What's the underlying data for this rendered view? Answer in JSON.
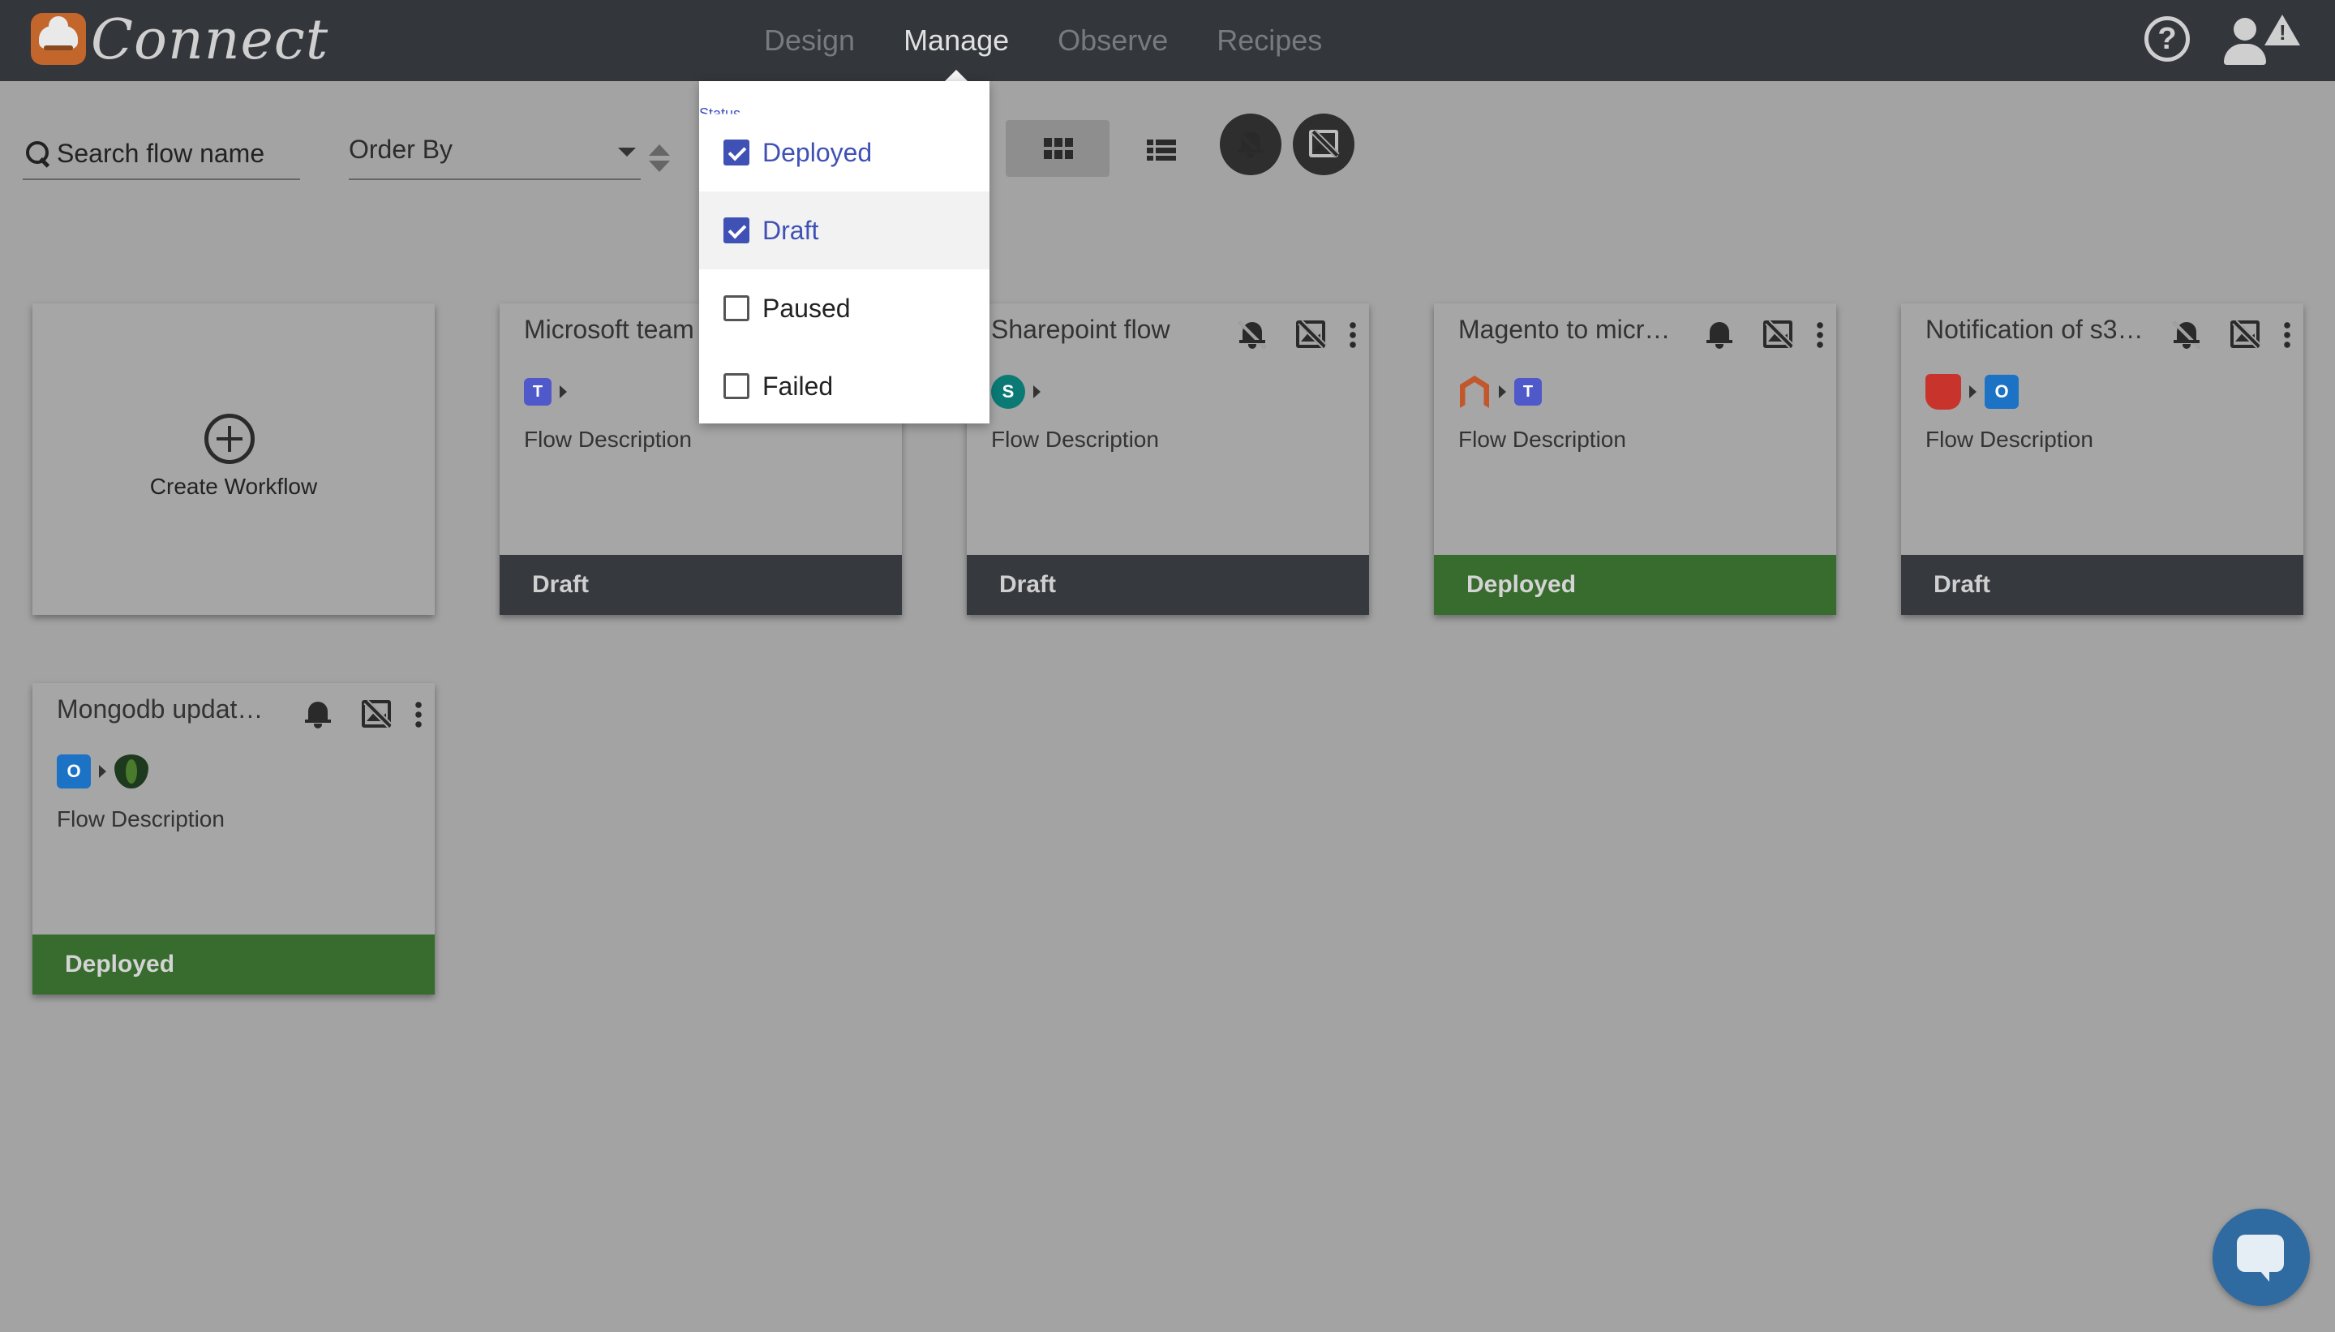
{
  "app": {
    "brand": "Connect",
    "nav": [
      {
        "label": "Design",
        "active": false
      },
      {
        "label": "Manage",
        "active": true
      },
      {
        "label": "Observe",
        "active": false
      },
      {
        "label": "Recipes",
        "active": false
      }
    ],
    "help_glyph": "?",
    "warning_glyph": "!"
  },
  "toolbar": {
    "search_placeholder": "Search flow name",
    "order_by_label": "Order By"
  },
  "status_filter": {
    "label": "Status",
    "options": [
      {
        "label": "Deployed",
        "checked": true
      },
      {
        "label": "Draft",
        "checked": true
      },
      {
        "label": "Paused",
        "checked": false
      },
      {
        "label": "Failed",
        "checked": false
      }
    ]
  },
  "create_card": {
    "label": "Create Workflow"
  },
  "cards": [
    {
      "title": "Microsoft team",
      "description": "Flow Description",
      "status": "Draft",
      "bell": "off",
      "connectors": [
        "teams-logo"
      ]
    },
    {
      "title": "Sharepoint flow",
      "description": "Flow Description",
      "status": "Draft",
      "bell": "off",
      "connectors": [
        "sharepoint-logo"
      ]
    },
    {
      "title": "Magento to micr…",
      "description": "Flow Description",
      "status": "Deployed",
      "bell": "on",
      "connectors": [
        "magento-logo",
        "teams-logo"
      ]
    },
    {
      "title": "Notification of s3 …",
      "description": "Flow Description",
      "status": "Draft",
      "bell": "off",
      "connectors": [
        "s3-bucket-logo",
        "outlook-logo"
      ]
    },
    {
      "title": "Mongodb updat…",
      "description": "Flow Description",
      "status": "Deployed",
      "bell": "on",
      "connectors": [
        "outlook-logo",
        "mongodb-logo"
      ]
    }
  ],
  "logo_letters": {
    "teams": "T",
    "sharepoint": "S",
    "outlook": "O"
  },
  "colors": {
    "topbar": "#33363b",
    "draft": "#363a3f",
    "deployed": "#386c2e",
    "accent": "#3f51b5",
    "chat": "#2f6aa0"
  }
}
